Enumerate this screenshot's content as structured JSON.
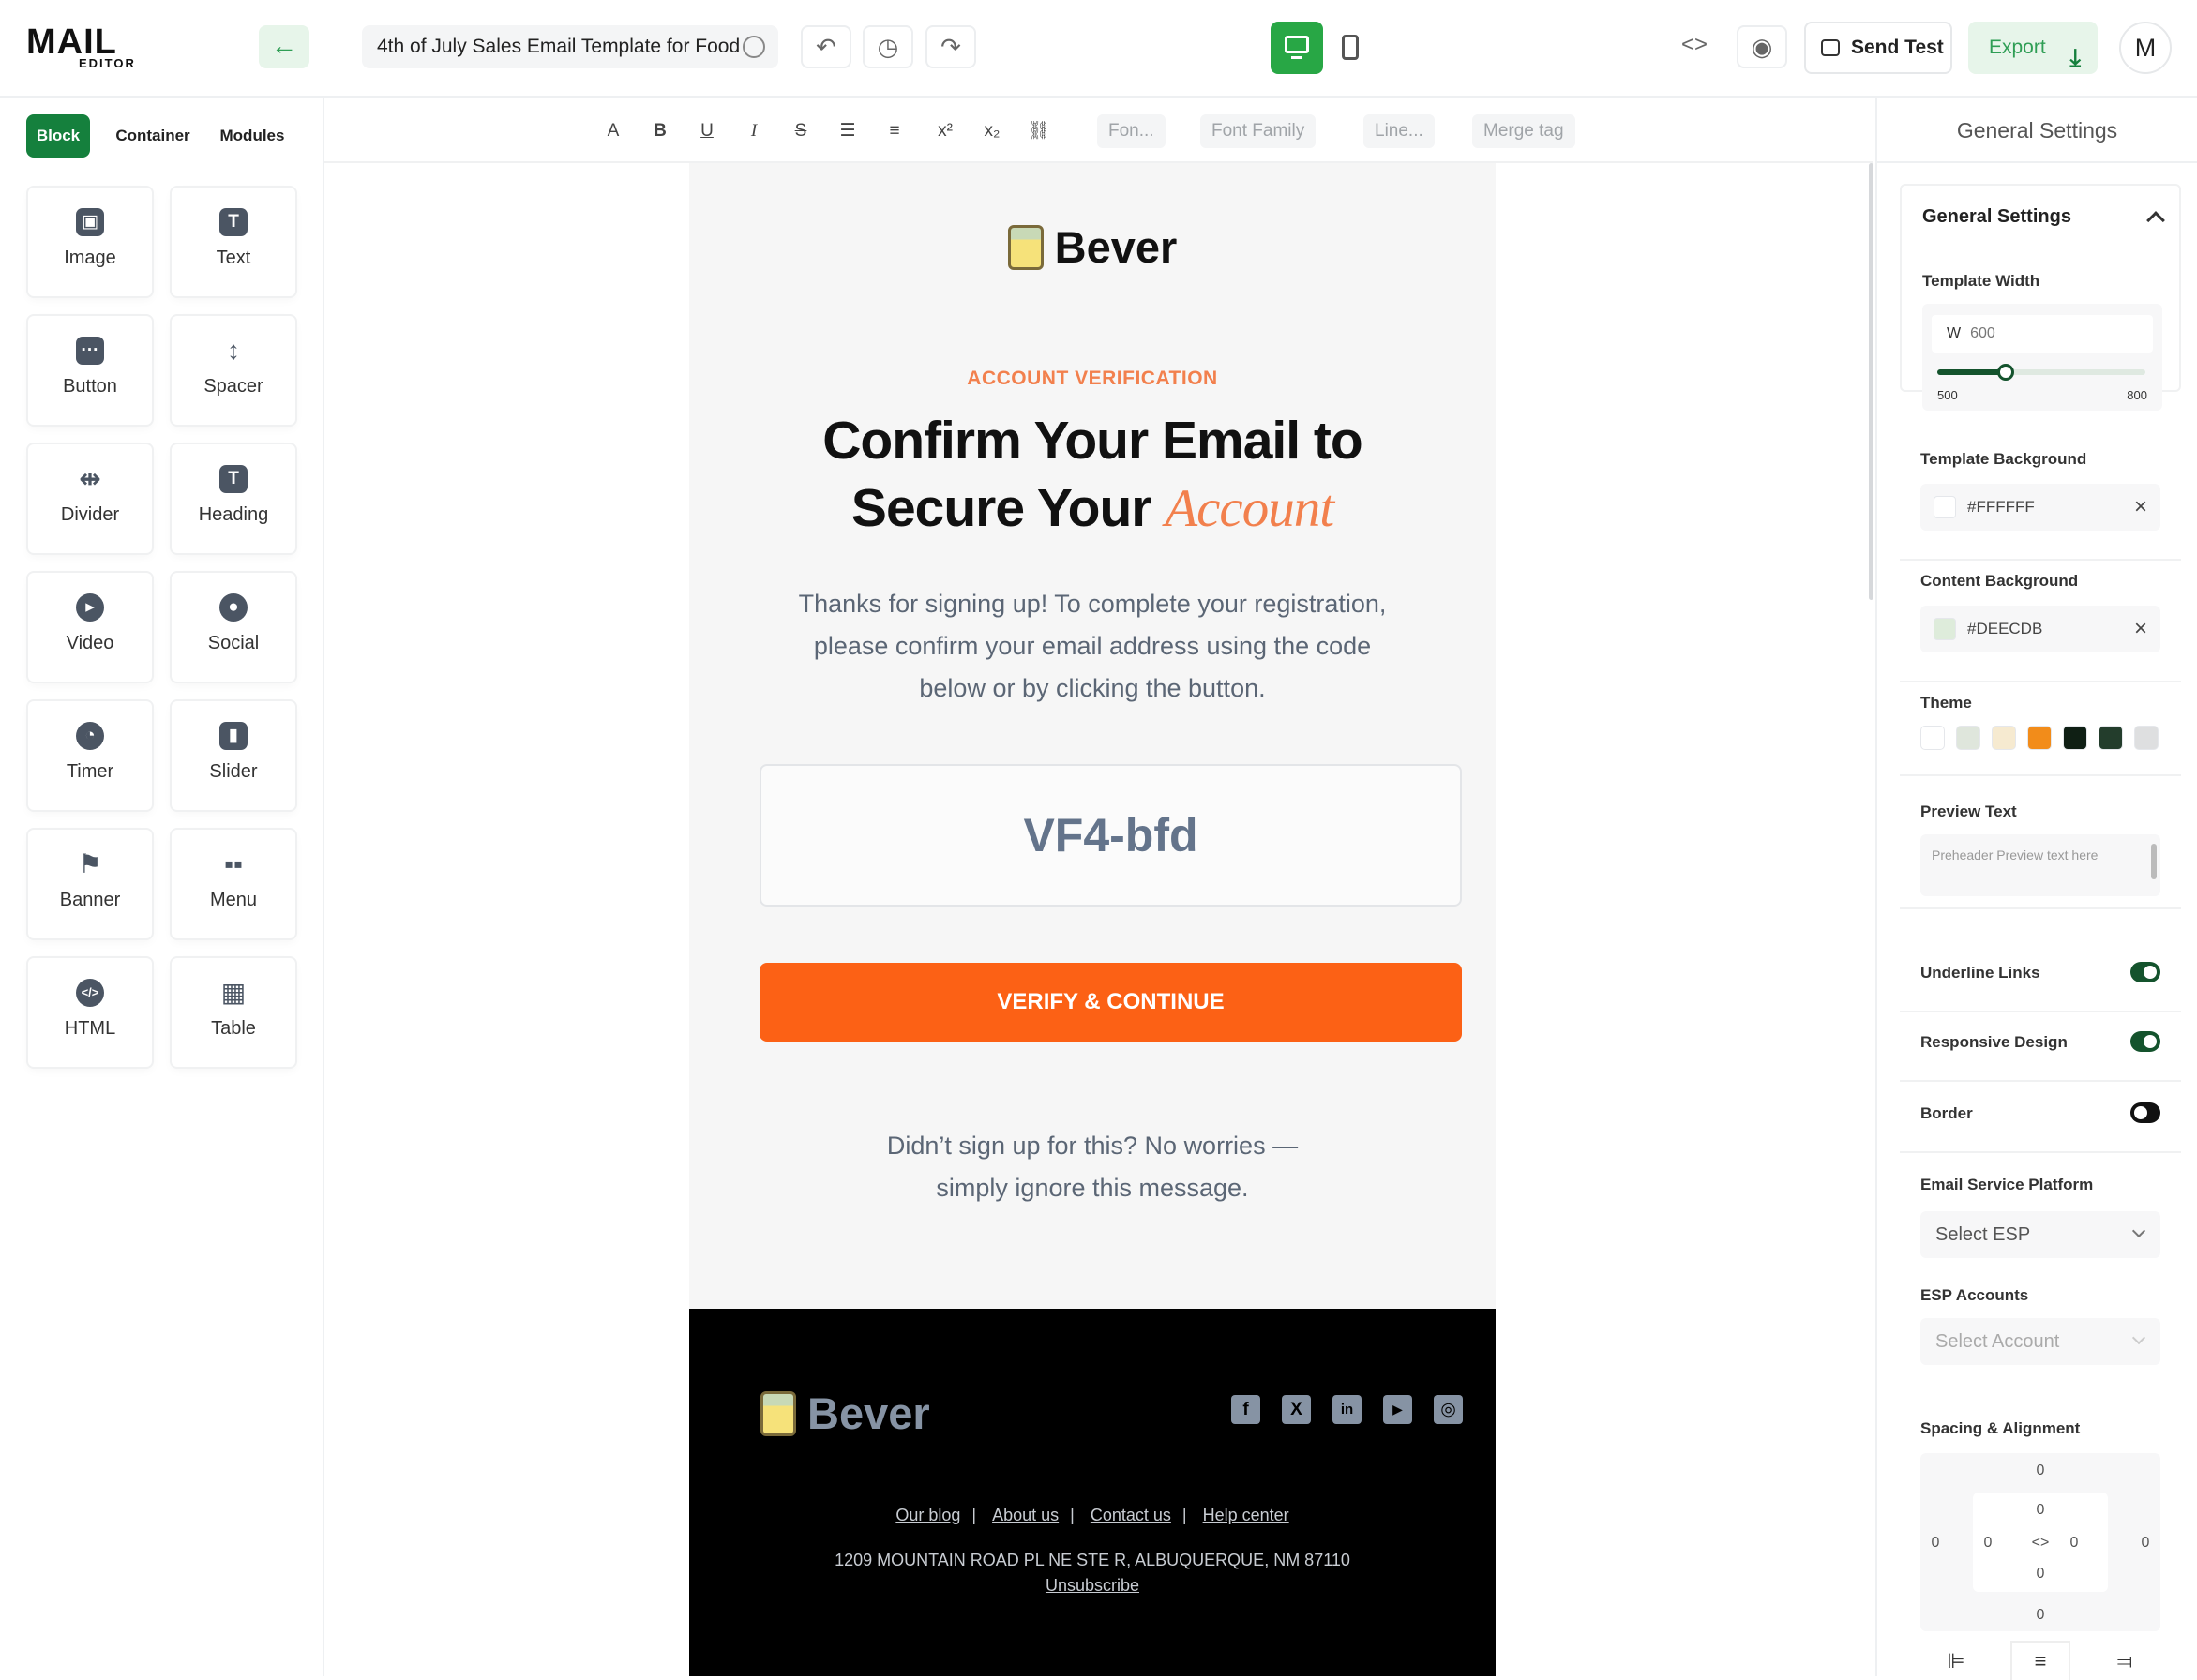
{
  "app": {
    "logo_big": "MAIL",
    "logo_small": "EDITOR"
  },
  "header": {
    "template_title": "4th of July Sales Email Template for Food",
    "send_test_label": "Send Test",
    "export_label": "Export",
    "avatar_initial": "M"
  },
  "sidebar": {
    "tabs": [
      {
        "label": "Block",
        "active": true
      },
      {
        "label": "Container",
        "active": false
      },
      {
        "label": "Modules",
        "active": false
      }
    ],
    "blocks": [
      {
        "label": "Image",
        "icon": "image-icon"
      },
      {
        "label": "Text",
        "icon": "text-icon"
      },
      {
        "label": "Button",
        "icon": "button-icon"
      },
      {
        "label": "Spacer",
        "icon": "spacer-icon"
      },
      {
        "label": "Divider",
        "icon": "divider-icon"
      },
      {
        "label": "Heading",
        "icon": "heading-icon"
      },
      {
        "label": "Video",
        "icon": "video-icon"
      },
      {
        "label": "Social",
        "icon": "social-icon"
      },
      {
        "label": "Timer",
        "icon": "timer-icon"
      },
      {
        "label": "Slider",
        "icon": "slider-icon"
      },
      {
        "label": "Banner",
        "icon": "banner-icon"
      },
      {
        "label": "Menu",
        "icon": "menu-icon"
      },
      {
        "label": "HTML",
        "icon": "html-icon"
      },
      {
        "label": "Table",
        "icon": "table-icon"
      }
    ]
  },
  "toolbar": {
    "font_size_placeholder": "Fon...",
    "font_family_placeholder": "Font Family",
    "line_height_placeholder": "Line...",
    "merge_tag_placeholder": "Merge tag"
  },
  "email": {
    "brand": "Bever",
    "eyebrow": "ACCOUNT VERIFICATION",
    "headline_line1": "Confirm Your Email to",
    "headline_line2": "Secure Your",
    "headline_accent": "Account",
    "body": "Thanks for signing up! To complete your registration, please confirm your email address using the code below or by clicking the button.",
    "code": "VF4-bfd",
    "cta": "VERIFY & CONTINUE",
    "footnote": "Didn’t sign up for this? No worries — simply ignore this message.",
    "footer": {
      "brand": "Bever",
      "links": [
        "Our blog",
        "About us",
        "Contact us",
        "Help center"
      ],
      "address": "1209 MOUNTAIN ROAD PL NE STE R, ALBUQUERQUE, NM 87110",
      "unsubscribe": "Unsubscribe",
      "social_icons": [
        "facebook-icon",
        "x-icon",
        "linkedin-icon",
        "youtube-icon",
        "instagram-icon"
      ]
    }
  },
  "right_panel": {
    "header": "General Settings",
    "section_title": "General Settings",
    "template_width_label": "Template Width",
    "template_width_prefix": "W",
    "template_width_value": "600",
    "template_width_min": "500",
    "template_width_max": "800",
    "template_width_fraction": 0.33,
    "template_background_label": "Template Background",
    "template_background_value": "#FFFFFF",
    "content_background_label": "Content Background",
    "content_background_value": "#DEECDB",
    "theme_label": "Theme",
    "theme_colors": [
      "#ffffff",
      "#dfe6dc",
      "#f6ead0",
      "#f28c1a",
      "#0f1f14",
      "#233d2c",
      "#dedfe0"
    ],
    "preview_text_label": "Preview Text",
    "preview_text_placeholder": "Preheader Preview text here",
    "underline_links_label": "Underline Links",
    "underline_links_on": true,
    "responsive_design_label": "Responsive Design",
    "responsive_design_on": true,
    "border_label": "Border",
    "border_on": false,
    "esp_label": "Email Service Platform",
    "esp_value": "Select ESP",
    "esp_accounts_label": "ESP Accounts",
    "esp_accounts_value": "Select Account",
    "spacing_label": "Spacing & Alignment",
    "spacing_values": {
      "margin_top": "0",
      "margin_right": "0",
      "margin_bottom": "0",
      "margin_left": "0",
      "padding_top": "0",
      "padding_right": "0",
      "padding_bottom": "0",
      "padding_left": "0"
    }
  },
  "colors": {
    "brand_green": "#15803d",
    "cta_orange": "#fc6115",
    "accent_orange": "#f2804d"
  }
}
